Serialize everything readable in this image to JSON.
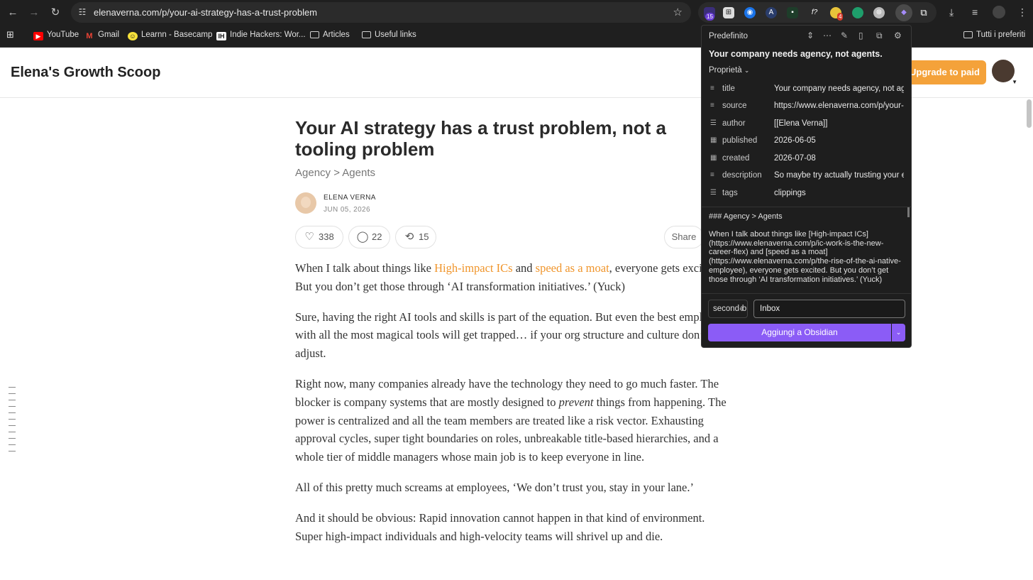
{
  "browser": {
    "url": "elenaverna.com/p/your-ai-strategy-has-a-trust-problem",
    "extension_badge_count": "15",
    "extension_badge_count_2": "4",
    "bookmarks": [
      {
        "label": "YouTube",
        "icon": "youtube-icon",
        "color": "#ff0000"
      },
      {
        "label": "Gmail",
        "icon": "gmail-icon",
        "color": "#ea4335"
      },
      {
        "label": "Learnn - Basecamp",
        "icon": "basecamp-icon",
        "color": "#f6e13a"
      },
      {
        "label": "Indie Hackers: Wor...",
        "icon": "indiehackers-icon",
        "color": "#ffffff"
      },
      {
        "label": "Articles",
        "icon": "folder-icon",
        "color": "#cfcfcf"
      },
      {
        "label": "Useful links",
        "icon": "folder-icon",
        "color": "#cfcfcf"
      }
    ],
    "other_bookmarks": "Tutti i preferiti"
  },
  "site": {
    "title": "Elena's Growth Scoop",
    "upgrade_label": "Upgrade to paid"
  },
  "article": {
    "title": "Your AI strategy has a trust problem, not a tooling problem",
    "breadcrumb": "Agency > Agents",
    "author": "ELENA VERNA",
    "date": "JUN 05, 2026",
    "likes": "338",
    "comments": "22",
    "restacks": "15",
    "share_label": "Share",
    "p1_a": "When I talk about things like ",
    "p1_link1": "High-impact ICs",
    "p1_b": " and ",
    "p1_link2": "speed as a moat",
    "p1_c": ", everyone gets excited. But you don’t get those through ‘AI transformation initiatives.’ (Yuck)",
    "p2": "Sure, having the right AI tools and skills is part of the equation. But even the best employees with all the most magical tools will get trapped… if your org structure and culture don’t adjust.",
    "p3_a": "Right now, many companies already have the technology they need to go much faster. The blocker is company systems that are mostly designed to ",
    "p3_em": "prevent",
    "p3_b": " things from happening. The power is centralized and all the team members are treated like a risk vector. Exhausting approval cycles, super tight boundaries on roles, unbreakable title-based hierarchies, and a whole tier of middle managers whose main job is to keep everyone in line.",
    "p4": "All of this pretty much screams at employees, ‘We don’t trust you, stay in your lane.’",
    "p5": "And it should be obvious: Rapid innovation cannot happen in that kind of environment. Super high-impact individuals and high-velocity teams will shrivel up and die."
  },
  "clipper": {
    "template": "Predefinito",
    "note_title": "Your company needs agency, not agents.",
    "properties_label": "Proprietà",
    "properties": [
      {
        "key": "title",
        "value": "Your company needs agency, not agents.",
        "icon": "text-icon"
      },
      {
        "key": "source",
        "value": "https://www.elenaverna.com/p/your-ai-strategy-has-a-trust-problem",
        "icon": "text-icon"
      },
      {
        "key": "author",
        "value": "[[Elena Verna]]",
        "icon": "list-icon"
      },
      {
        "key": "published",
        "value": "2026-06-05",
        "icon": "calendar-icon"
      },
      {
        "key": "created",
        "value": "2026-07-08",
        "icon": "calendar-icon"
      },
      {
        "key": "description",
        "value": "So maybe try actually trusting your employees",
        "icon": "text-icon"
      },
      {
        "key": "tags",
        "value": "clippings",
        "icon": "list-icon"
      }
    ],
    "markdown_heading": "### Agency > Agents",
    "markdown_body": "When I talk about things like [High-impact ICs](https://www.elenaverna.com/p/ic-work-is-the-new-career-flex) and [speed as a moat](https://www.elenaverna.com/p/the-rise-of-the-ai-native-employee), everyone gets excited. But you don’t get those through ‘AI transformation initiatives.’ (Yuck)",
    "vault": "second-brain",
    "folder": "Inbox",
    "add_label": "Aggiungi a Obsidian",
    "accent": "#8b5cf6"
  }
}
